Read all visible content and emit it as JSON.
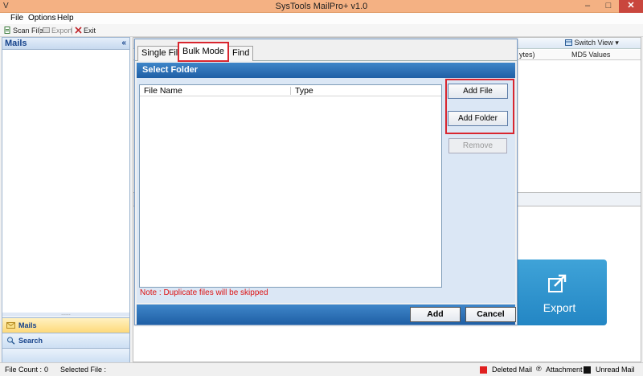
{
  "window": {
    "title": "SysTools MailPro+ v1.0",
    "app_icon": "V"
  },
  "menu": {
    "items": [
      "File",
      "Options",
      "Help"
    ]
  },
  "toolbar": {
    "scan_file": "Scan File",
    "export": "Export",
    "exit": "Exit"
  },
  "left_panel": {
    "header": "Mails",
    "collapse": "«",
    "grip": "......",
    "nav": {
      "mails": "Mails",
      "search": "Search"
    }
  },
  "right_area": {
    "switch_view": "Switch View",
    "col_bytes": "ytes)",
    "col_md5": "MD5 Values"
  },
  "export_tile": {
    "label": "Export"
  },
  "status": {
    "file_count_label": "File Count :",
    "file_count_value": "0",
    "selected_file_label": "Selected File :",
    "legend": {
      "deleted": "Deleted Mail",
      "attachment": "Attachment",
      "unread": "Unread Mail"
    },
    "colors": {
      "deleted": "#e02020",
      "unread": "#111111"
    }
  },
  "dialog": {
    "tabs": [
      "Single File",
      "Bulk Mode",
      "Find"
    ],
    "active_tab": "Bulk Mode",
    "section_title": "Select Folder",
    "columns": [
      "File Name",
      "Type"
    ],
    "buttons": {
      "add_file": "Add File",
      "add_folder": "Add Folder",
      "remove": "Remove",
      "add": "Add",
      "cancel": "Cancel"
    },
    "note": "Note : Duplicate files will be skipped"
  }
}
